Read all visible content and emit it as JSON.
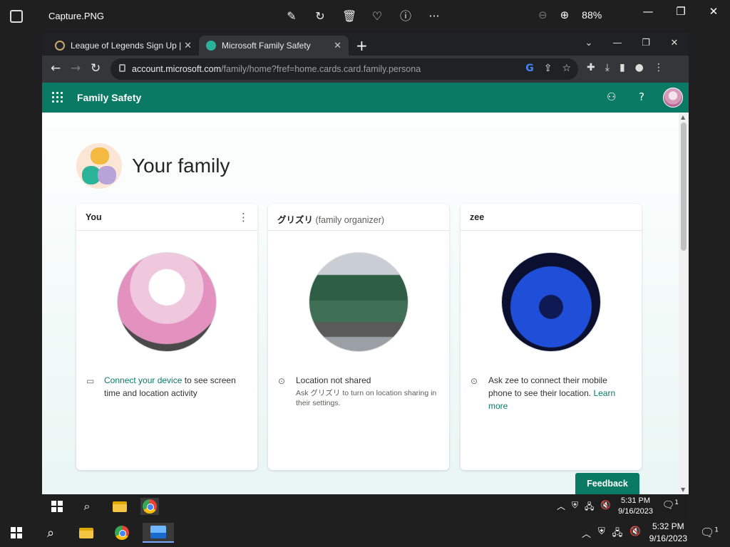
{
  "viewer": {
    "title": "Capture.PNG",
    "zoom": "88%",
    "tools": [
      "edit-icon",
      "rotate-icon",
      "delete-icon",
      "favorite-icon",
      "info-icon",
      "more-icon"
    ]
  },
  "browser": {
    "tabs": [
      {
        "label": "League of Legends Sign Up | No",
        "favicon_color": "#1e2328"
      },
      {
        "label": "Microsoft Family Safety",
        "favicon_color": "#2bb39a"
      }
    ],
    "url_host": "account.microsoft.com",
    "url_path": "/family/home?fref=home.cards.card.family.persona"
  },
  "app": {
    "title": "Family Safety",
    "accent": "#0b7a64"
  },
  "main": {
    "heading": "Your family",
    "cards": [
      {
        "name": "You",
        "role": "",
        "info": "",
        "link_text": "Connect your device",
        "info_rest": " to see screen time and location activity"
      },
      {
        "name": "グリズリ",
        "role": "(family organizer)",
        "info": "Location not shared",
        "small": "Ask グリズリ to turn on location sharing in their settings."
      },
      {
        "name": "zee",
        "role": "",
        "info": "Ask zee to connect their mobile phone to see their location. ",
        "link_text": "Learn more"
      }
    ],
    "feedback": "Feedback"
  },
  "inner_taskbar": {
    "time": "5:31 PM",
    "date": "9/16/2023",
    "notif_count": "1"
  },
  "outer_taskbar": {
    "time": "5:32 PM",
    "date": "9/16/2023",
    "notif_count": "1"
  }
}
